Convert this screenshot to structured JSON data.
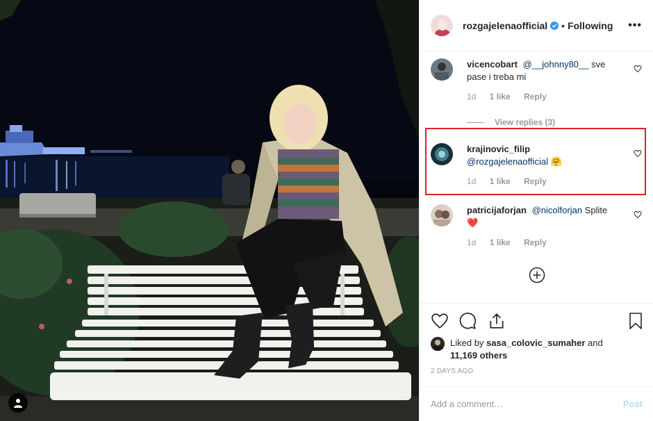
{
  "post": {
    "author": "rozgajelenaofficial",
    "separator": "•",
    "follow_status": "Following",
    "more_label": "•••"
  },
  "comments": [
    {
      "user": "vicencobart",
      "mention": "@__johnny80__",
      "text": "sve pase i treba mi",
      "age": "1d",
      "likes": "1 like",
      "reply": "Reply"
    },
    {
      "user": "krajinovic_filip",
      "mention": "@rozgajelenaofficial",
      "text": "🤗",
      "age": "1d",
      "likes": "1 like",
      "reply": "Reply"
    },
    {
      "user": "patricijaforjan",
      "mention": "@nicolforjan",
      "text": "Splite ❤️",
      "age": "1d",
      "likes": "1 like",
      "reply": "Reply"
    }
  ],
  "view_replies": "View replies (3)",
  "likes": {
    "prefix": "Liked by",
    "user": "sasa_colovic_sumaher",
    "middle": "and",
    "others": "11,169 others"
  },
  "timestamp": "2 DAYS AGO",
  "add_comment": {
    "placeholder": "Add a comment…",
    "post_label": "Post"
  },
  "colors": {
    "verified": "#3897f0",
    "highlight_box": "#e0202a",
    "post_disabled": "#b2dffc"
  },
  "icons": [
    "heart-icon",
    "comment-icon",
    "share-icon",
    "bookmark-icon",
    "add-circle-icon",
    "user-tag-icon",
    "verified-badge-icon",
    "more-options-icon"
  ]
}
